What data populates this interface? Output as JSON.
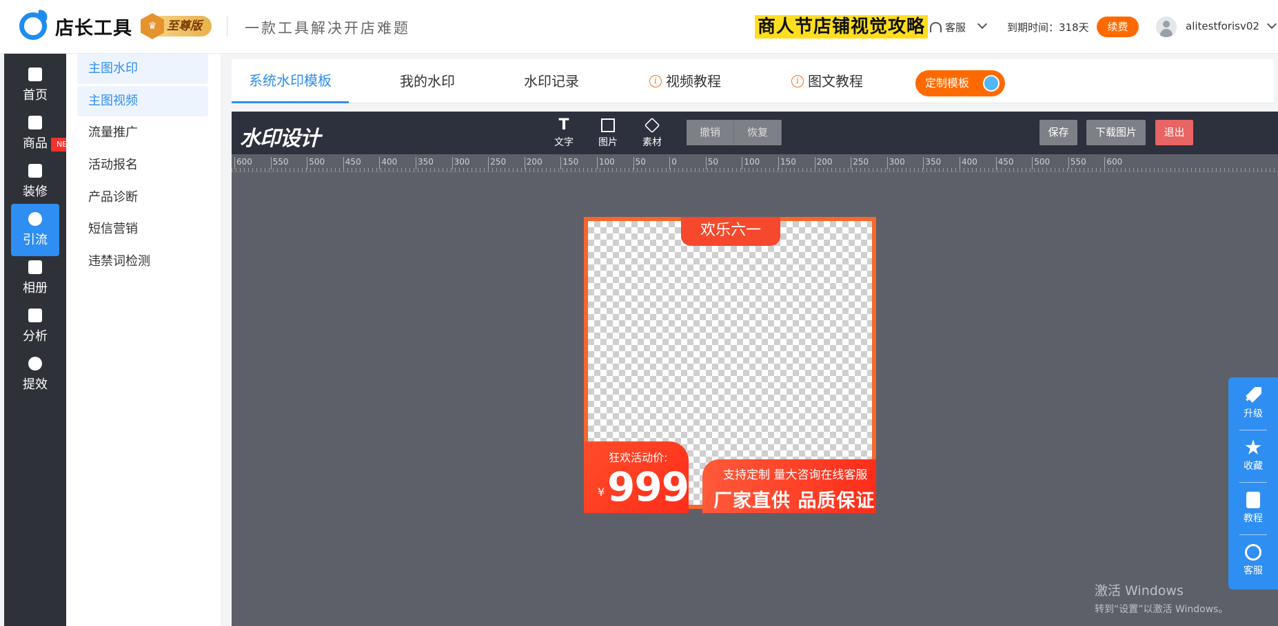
{
  "header": {
    "logo_text": "店长工具",
    "vip_badge": "至尊版",
    "slogan": "一款工具解决开店难题",
    "promo_banner": "商人节店铺视觉攻略",
    "service_label": "客服",
    "expire_label": "到期时间：318天",
    "renew_button": "续费",
    "username": "alitestforisv02"
  },
  "leftnav": {
    "items": [
      {
        "label": "首页",
        "icon": "home-icon"
      },
      {
        "label": "商品",
        "icon": "bag-icon"
      },
      {
        "label": "装修",
        "icon": "brush-icon"
      },
      {
        "label": "引流",
        "icon": "user-icon"
      },
      {
        "label": "相册",
        "icon": "album-icon"
      },
      {
        "label": "分析",
        "icon": "chart-icon"
      },
      {
        "label": "提效",
        "icon": "clock-icon"
      }
    ],
    "new_tag": "NEW",
    "active_index": 3
  },
  "submenu": {
    "items": [
      "主图水印",
      "主图视频",
      "流量推广",
      "活动报名",
      "产品诊断",
      "短信营销",
      "违禁词检测"
    ],
    "active_indices": [
      0,
      1
    ]
  },
  "tabs": {
    "items": [
      "系统水印模板",
      "我的水印",
      "水印记录",
      "视频教程",
      "图文教程"
    ],
    "active_index": 0,
    "custom_button": "定制模板"
  },
  "editor": {
    "title": "水印设计",
    "tools": [
      "文字",
      "图片",
      "素材"
    ],
    "undo": "撤销",
    "redo": "恢复",
    "save": "保存",
    "download": "下载图片",
    "exit": "退出",
    "ruler_ticks": [
      "600",
      "550",
      "500",
      "450",
      "400",
      "350",
      "300",
      "250",
      "200",
      "150",
      "100",
      "50",
      "0",
      "50",
      "100",
      "150",
      "200",
      "250",
      "300",
      "350",
      "400",
      "450",
      "500",
      "550",
      "600"
    ]
  },
  "watermark_template": {
    "holiday_label": "欢乐六一",
    "price_label": "狂欢活动价:",
    "currency": "¥",
    "price": "999",
    "slogan_line1": "支持定制 量大咨询在线客服",
    "slogan_line2": "厂家直供 品质保证"
  },
  "float_panel": {
    "items": [
      {
        "label": "升级",
        "icon": "rocket-icon"
      },
      {
        "label": "收藏",
        "icon": "star-icon"
      },
      {
        "label": "教程",
        "icon": "document-icon"
      },
      {
        "label": "客服",
        "icon": "customer-service-icon"
      }
    ]
  },
  "os_watermark": {
    "line1": "激活 Windows",
    "line2": "转到“设置”以激活 Windows。"
  },
  "colors": {
    "accent": "#2f8ef1",
    "orange": "#ff6a00",
    "nav_bg": "#2f3138",
    "editor_bg": "#5d6069"
  }
}
